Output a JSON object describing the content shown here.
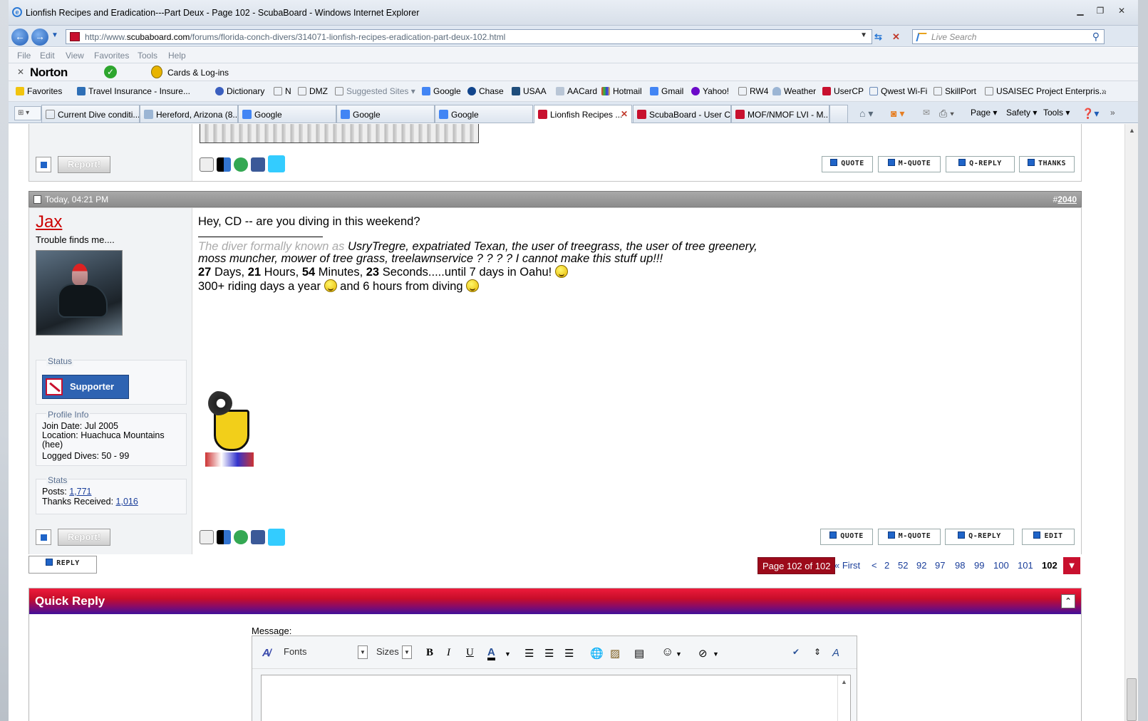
{
  "window": {
    "title": "Lionfish Recipes and Eradication---Part Deux - Page 102 - ScubaBoard - Windows Internet Explorer"
  },
  "address": {
    "url_prefix": "http://www.",
    "url_domain": "scubaboard.com",
    "url_path": "/forums/florida-conch-divers/314071-lionfish-recipes-eradication-part-deux-102.html"
  },
  "search": {
    "placeholder": "Live Search"
  },
  "menu": [
    "File",
    "Edit",
    "View",
    "Favorites",
    "Tools",
    "Help"
  ],
  "norton": {
    "brand": "Norton",
    "cards": "Cards & Log-ins"
  },
  "favorites": {
    "label": "Favorites",
    "items": [
      "Travel Insurance - Insure...",
      "Dictionary",
      "N",
      "DMZ",
      "Suggested Sites",
      "Google",
      "Chase",
      "USAA",
      "AACard",
      "Hotmail",
      "Gmail",
      "Yahoo!",
      "RW4",
      "Weather",
      "UserCP",
      "Qwest Wi-Fi",
      "SkillPort",
      "USAISEC Project Enterpris..."
    ]
  },
  "tabs": [
    "Current Dive conditi...",
    "Hereford, Arizona (8...",
    "Google",
    "Google",
    "Google",
    "Lionfish Recipes ...",
    "ScubaBoard - User C...",
    "MOF/NMOF LVI - M..."
  ],
  "commands": {
    "page": "Page",
    "safety": "Safety",
    "tools": "Tools"
  },
  "post_buttons": {
    "report": "Report!",
    "quote": "QUOTE",
    "mquote": "M-QUOTE",
    "qreply": "Q-REPLY",
    "thanks": "THANKS",
    "edit": "EDIT"
  },
  "post": {
    "date": "Today, 04:21 PM",
    "number_hash": "#",
    "number": "2040",
    "username": "Jax",
    "user_title": "Trouble finds me....",
    "status_label": "Status",
    "status_badge": "Supporter",
    "profile_label": "Profile Info",
    "join_date": "Join Date: Jul 2005",
    "location": "Location: Huachuca Mountains (hee)",
    "logged_dives": "Logged Dives: 50 - 99",
    "stats_label": "Stats",
    "posts_label": "Posts: ",
    "posts_value": "1,771",
    "thanks_label": "Thanks Received: ",
    "thanks_value": "1,016",
    "message": "Hey, CD -- are you diving in this weekend?",
    "sig_intro": "The diver formally known as ",
    "sig_names_1": "UsryTregre, expatriated Texan, the user of treegrass, the user of tree greenery,",
    "sig_names_2": "moss muncher, mower of tree grass, treelawnservice ? ? ? ? I cannot make this stuff up!!!",
    "countdown": {
      "days": "27",
      "days_label": " Days, ",
      "hours": "21",
      "hours_label": " Hours, ",
      "minutes": "54",
      "minutes_label": " Minutes, ",
      "seconds": "23",
      "seconds_label": " Seconds.....until 7 days in Oahu! "
    },
    "sig_riding": "300+ riding days a year ",
    "sig_riding_2": " and 6 hours from diving "
  },
  "reply_button": "REPLY",
  "pagination": {
    "current": "Page 102 of 102",
    "first": "« First",
    "prev": "<",
    "pages": [
      "2",
      "52",
      "92",
      "97",
      "98",
      "99",
      "100",
      "101"
    ],
    "last": "102"
  },
  "quick_reply": {
    "title": "Quick Reply",
    "message_label": "Message:",
    "fonts": "Fonts",
    "sizes": "Sizes"
  },
  "colors": {
    "brand_red": "#c8102e",
    "accent_blue": "#1f64c8"
  }
}
